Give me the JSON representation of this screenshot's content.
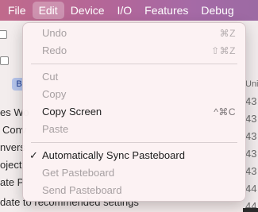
{
  "menubar": {
    "items": [
      {
        "label": "File"
      },
      {
        "label": "Edit"
      },
      {
        "label": "Device"
      },
      {
        "label": "I/O"
      },
      {
        "label": "Features"
      },
      {
        "label": "Debug"
      }
    ],
    "active": "Edit"
  },
  "edit_menu": {
    "items": [
      {
        "label": "Undo",
        "shortcut": "⌘Z",
        "enabled": false
      },
      {
        "label": "Redo",
        "shortcut": "⇧⌘Z",
        "enabled": false
      },
      {
        "label": "Cut",
        "shortcut": "",
        "enabled": false
      },
      {
        "label": "Copy",
        "shortcut": "",
        "enabled": false
      },
      {
        "label": "Copy Screen",
        "shortcut": "^⌘C",
        "enabled": true
      },
      {
        "label": "Paste",
        "shortcut": "",
        "enabled": false
      },
      {
        "label": "Automatically Sync Pasteboard",
        "shortcut": "",
        "enabled": true,
        "checked": true,
        "check_mark": "✓"
      },
      {
        "label": "Get Pasteboard",
        "shortcut": "",
        "enabled": false
      },
      {
        "label": "Send Pasteboard",
        "shortcut": "",
        "enabled": false
      }
    ]
  },
  "background": {
    "left_lines": [
      "es Wo",
      "Conv",
      "nvers",
      "oject",
      "ate P",
      "date P"
    ],
    "left_pill": "B",
    "bottom_line": "date to recommended settings",
    "right_lines": [
      "Uni",
      "43",
      "43",
      "43",
      "43",
      "43",
      "44",
      "44",
      "44",
      "44",
      "44"
    ]
  }
}
